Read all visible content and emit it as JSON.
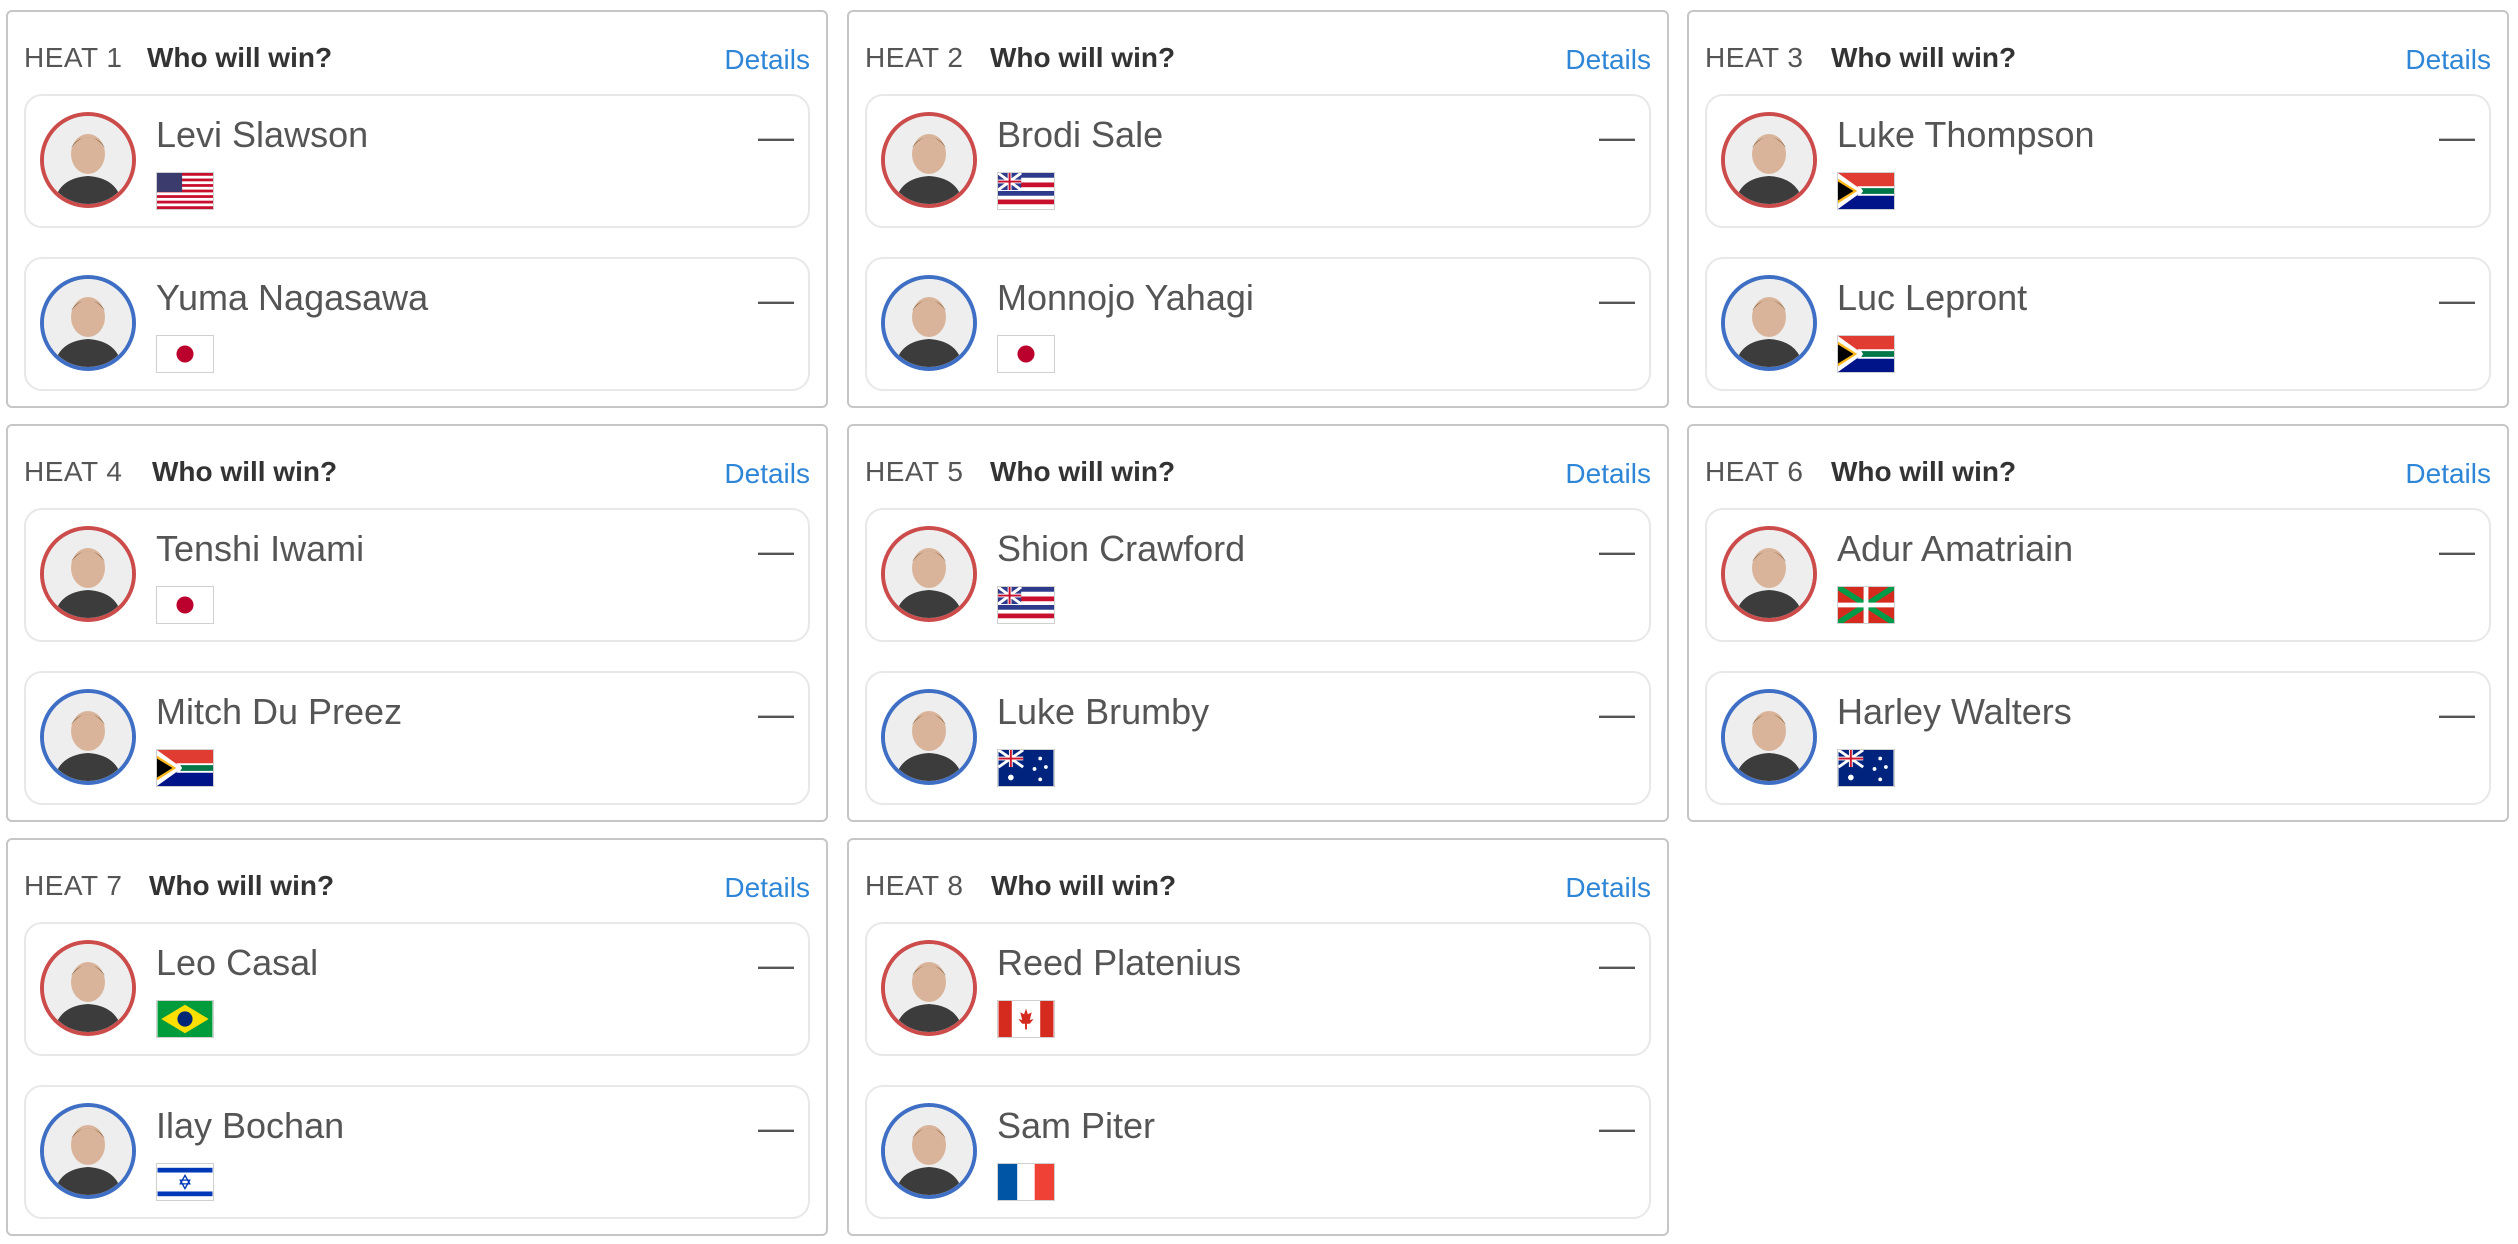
{
  "question": "Who will win?",
  "details_label": "Details",
  "colors": {
    "red_ring": "#cc4b4b",
    "blue_ring": "#3f6fc4",
    "link": "#2f86d6"
  },
  "heats": [
    {
      "label": "HEAT 1",
      "question": "Who will win?",
      "details": "Details",
      "surfers": [
        {
          "name": "Levi Slawson",
          "flag": "usa-flag",
          "score": "—"
        },
        {
          "name": "Yuma Nagasawa",
          "flag": "japan-flag",
          "score": "—"
        }
      ]
    },
    {
      "label": "HEAT 2",
      "question": "Who will win?",
      "details": "Details",
      "surfers": [
        {
          "name": "Brodi Sale",
          "flag": "hawaii-flag",
          "score": "—"
        },
        {
          "name": "Monnojo Yahagi",
          "flag": "japan-flag",
          "score": "—"
        }
      ]
    },
    {
      "label": "HEAT 3",
      "question": "Who will win?",
      "details": "Details",
      "surfers": [
        {
          "name": "Luke Thompson",
          "flag": "south-africa-flag",
          "score": "—"
        },
        {
          "name": "Luc Lepront",
          "flag": "south-africa-flag",
          "score": "—"
        }
      ]
    },
    {
      "label": "HEAT 4",
      "question": "Who will win?",
      "details": "Details",
      "surfers": [
        {
          "name": "Tenshi Iwami",
          "flag": "japan-flag",
          "score": "—"
        },
        {
          "name": "Mitch Du Preez",
          "flag": "south-africa-flag",
          "score": "—"
        }
      ]
    },
    {
      "label": "HEAT 5",
      "question": "Who will win?",
      "details": "Details",
      "surfers": [
        {
          "name": "Shion Crawford",
          "flag": "hawaii-flag",
          "score": "—"
        },
        {
          "name": "Luke Brumby",
          "flag": "australia-flag",
          "score": "—"
        }
      ]
    },
    {
      "label": "HEAT 6",
      "question": "Who will win?",
      "details": "Details",
      "surfers": [
        {
          "name": "Adur Amatriain",
          "flag": "basque-flag",
          "score": "—"
        },
        {
          "name": "Harley Walters",
          "flag": "australia-flag",
          "score": "—"
        }
      ]
    },
    {
      "label": "HEAT 7",
      "question": "Who will win?",
      "details": "Details",
      "surfers": [
        {
          "name": "Leo Casal",
          "flag": "brazil-flag",
          "score": "—"
        },
        {
          "name": "Ilay Bochan",
          "flag": "israel-flag",
          "score": "—"
        }
      ]
    },
    {
      "label": "HEAT 8",
      "question": "Who will win?",
      "details": "Details",
      "surfers": [
        {
          "name": "Reed Platenius",
          "flag": "canada-flag",
          "score": "—"
        },
        {
          "name": "Sam Piter",
          "flag": "france-flag",
          "score": "—"
        }
      ]
    }
  ]
}
